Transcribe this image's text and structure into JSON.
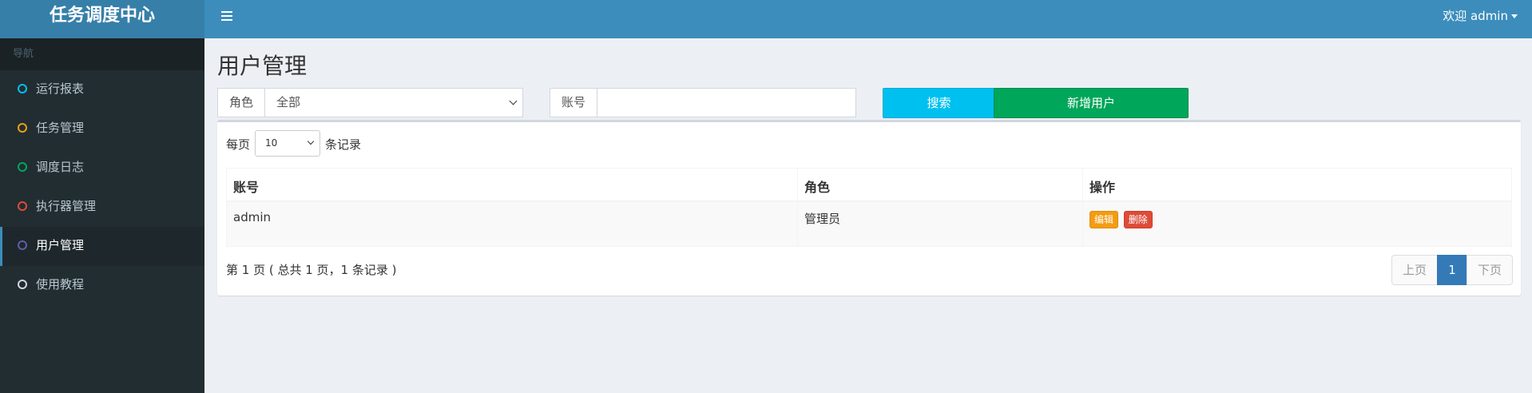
{
  "app": {
    "title": "任务调度中心"
  },
  "header": {
    "welcome": "欢迎 admin"
  },
  "sidebar": {
    "section_label": "导航",
    "items": [
      {
        "label": "运行报表",
        "color": "#00c0ef"
      },
      {
        "label": "任务管理",
        "color": "#f39c12"
      },
      {
        "label": "调度日志",
        "color": "#00a65a"
      },
      {
        "label": "执行器管理",
        "color": "#dd4b39"
      },
      {
        "label": "用户管理",
        "color": "#605ca8"
      },
      {
        "label": "使用教程",
        "color": "#d2d6de"
      }
    ],
    "active_index": 4
  },
  "page": {
    "title": "用户管理"
  },
  "filters": {
    "role_label": "角色",
    "role_value": "全部",
    "account_label": "账号",
    "account_value": "",
    "search_button": "搜索",
    "add_button": "新增用户"
  },
  "table": {
    "length_prefix": "每页",
    "length_value": "10",
    "length_suffix": "条记录",
    "columns": [
      "账号",
      "角色",
      "操作"
    ],
    "rows": [
      {
        "account": "admin",
        "role": "管理员",
        "edit": "编辑",
        "delete": "删除"
      }
    ],
    "info": "第 1 页 ( 总共 1 页，1 条记录 )",
    "pagination": {
      "prev": "上页",
      "current": "1",
      "next": "下页"
    }
  }
}
